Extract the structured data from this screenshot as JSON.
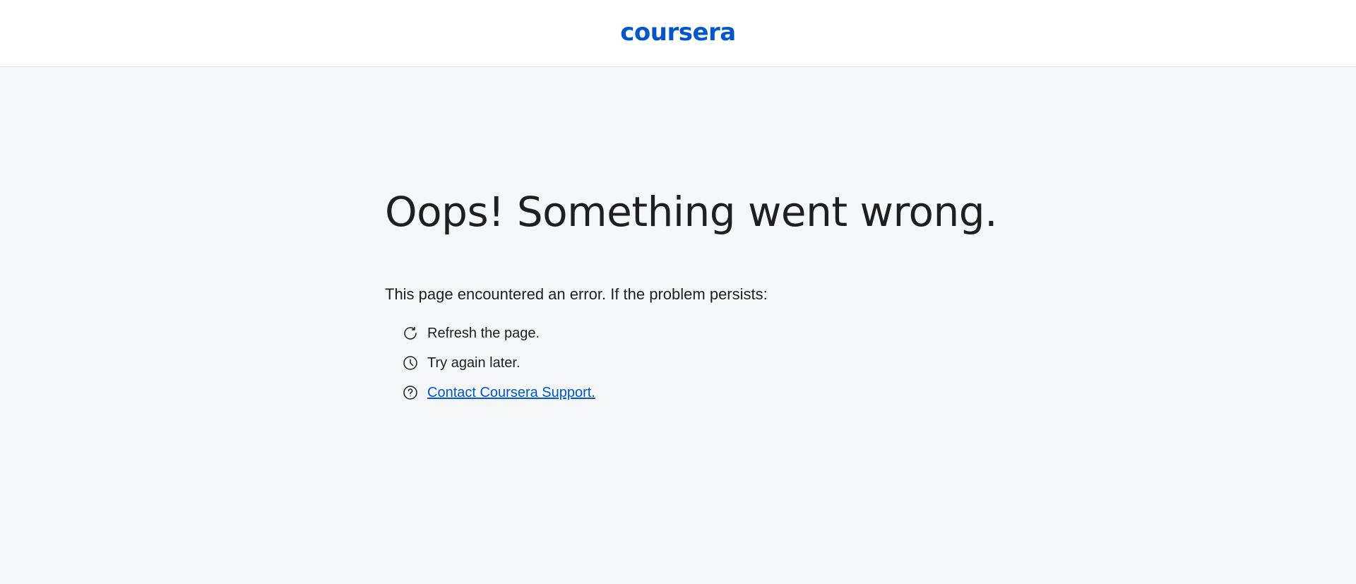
{
  "header": {
    "logo_text": "coursera",
    "brand_color": "#0056d2"
  },
  "error": {
    "title": "Oops! Something went wrong.",
    "intro": "This page encountered an error. If the problem persists:",
    "steps": [
      {
        "icon": "refresh-icon",
        "label": "Refresh the page."
      },
      {
        "icon": "clock-icon",
        "label": "Try again later."
      },
      {
        "icon": "help-circle-icon",
        "label": "Contact Coursera Support.",
        "is_link": true
      }
    ]
  },
  "colors": {
    "background": "#f5f6f8",
    "header_background": "#ffffff",
    "text": "#1f1f1f",
    "link": "#0056d2"
  }
}
